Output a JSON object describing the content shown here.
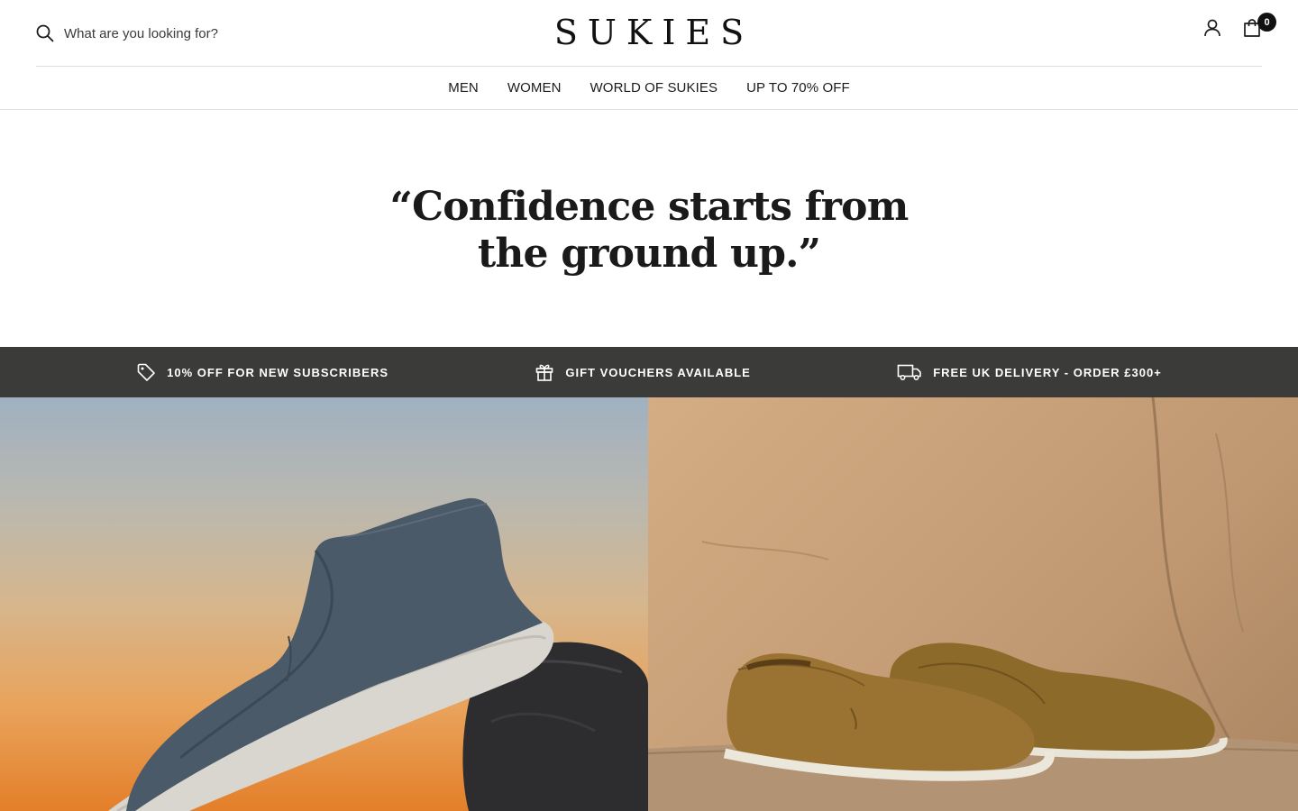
{
  "header": {
    "search_placeholder": "What are you looking for?",
    "logo": "SUKIES",
    "cart_count": "0"
  },
  "nav": {
    "items": [
      "MEN",
      "WOMEN",
      "WORLD OF SUKIES",
      "UP TO 70% OFF"
    ]
  },
  "hero": {
    "quote": "“Confidence starts from the ground up.”"
  },
  "promo": {
    "items": [
      {
        "icon": "tag-icon",
        "label": "10% OFF FOR NEW SUBSCRIBERS"
      },
      {
        "icon": "gift-icon",
        "label": "GIFT VOUCHERS AVAILABLE"
      },
      {
        "icon": "truck-icon",
        "label": "FREE UK DELIVERY - ORDER £300+"
      }
    ]
  },
  "images": {
    "left": "blue-grey suede loafer on rock at sunset",
    "right": "tan suede loafers on stone"
  }
}
